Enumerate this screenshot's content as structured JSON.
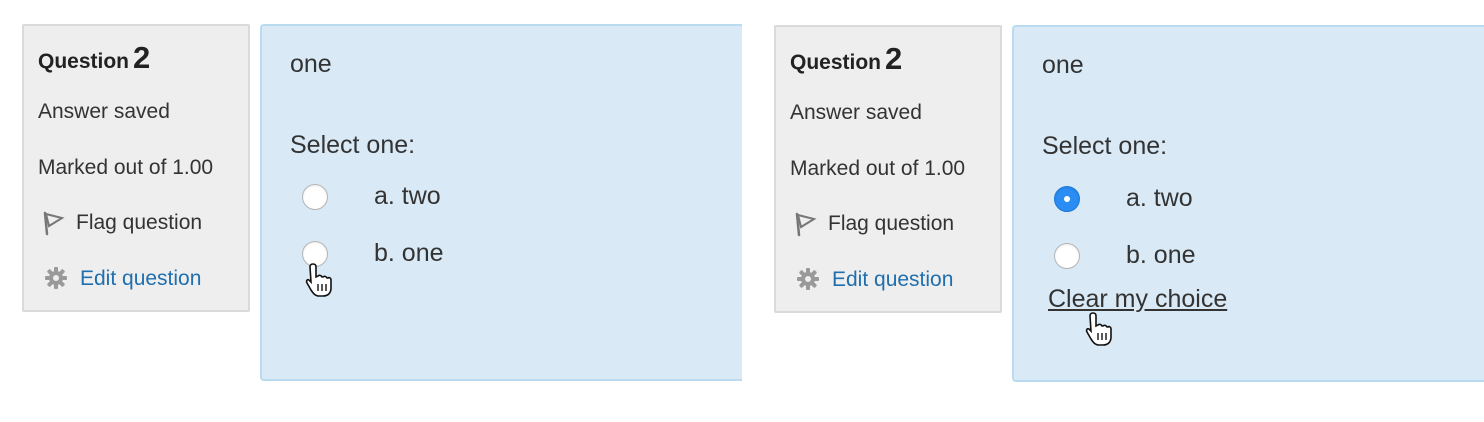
{
  "panels": [
    {
      "info": {
        "question_label": "Question",
        "question_number": "2",
        "state": "Answer saved",
        "grade": "Marked out of 1.00",
        "flag_label": "Flag question",
        "edit_label": "Edit question"
      },
      "content": {
        "question_text": "one",
        "prompt": "Select one:",
        "options": [
          {
            "label": "a. two",
            "checked": false
          },
          {
            "label": "b. one",
            "checked": false
          }
        ]
      }
    },
    {
      "info": {
        "question_label": "Question",
        "question_number": "2",
        "state": "Answer saved",
        "grade": "Marked out of 1.00",
        "flag_label": "Flag question",
        "edit_label": "Edit question"
      },
      "content": {
        "question_text": "one",
        "prompt": "Select one:",
        "options": [
          {
            "label": "a. two",
            "checked": true
          },
          {
            "label": "b. one",
            "checked": false
          }
        ],
        "clear_label": "Clear my choice"
      }
    }
  ],
  "colors": {
    "info_background": "#eeeeee",
    "content_background": "#d9eaf6",
    "link": "#1f6fae",
    "radio_checked": "#2b8cf3"
  },
  "icons": [
    "flag-icon",
    "gear-icon",
    "hand-pointer-cursor"
  ]
}
